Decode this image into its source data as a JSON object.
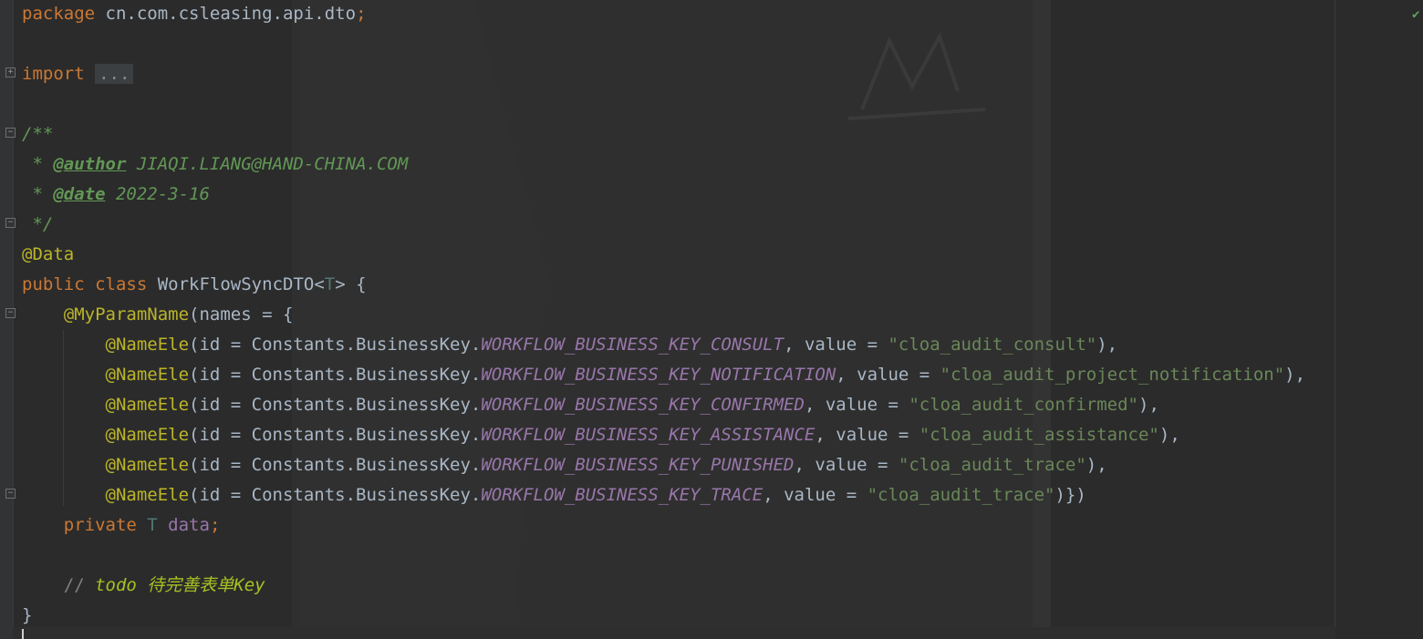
{
  "code": {
    "package_kw": "package",
    "package_name": " cn.com.csleasing.api.dto",
    "semi": ";",
    "import_kw": "import",
    "import_fold": "...",
    "doc_open": "/**",
    "doc_star": " * ",
    "author_tag": "@author",
    "author_value": " JIAQI.LIANG@HAND-CHINA.COM",
    "date_tag": "@date",
    "date_value": " 2022-3-16",
    "doc_close": " */",
    "data_ann": "@Data",
    "public_kw": "public",
    "class_kw": "class",
    "class_name": " WorkFlowSyncDTO<",
    "type_param": "T",
    "class_tail": "> {",
    "myparam_ann": "@MyParamName",
    "myparam_open": "(names = {",
    "name_ele_rows": [
      {
        "ann": "@NameEle",
        "pre": "(id = Constants.BusinessKey.",
        "key": "WORKFLOW_BUSINESS_KEY_CONSULT",
        "mid": ", value = ",
        "val": "\"cloa_audit_consult\"",
        "end": "),"
      },
      {
        "ann": "@NameEle",
        "pre": "(id = Constants.BusinessKey.",
        "key": "WORKFLOW_BUSINESS_KEY_NOTIFICATION",
        "mid": ", value = ",
        "val": "\"cloa_audit_project_notification\"",
        "end": "),"
      },
      {
        "ann": "@NameEle",
        "pre": "(id = Constants.BusinessKey.",
        "key": "WORKFLOW_BUSINESS_KEY_CONFIRMED",
        "mid": ", value = ",
        "val": "\"cloa_audit_confirmed\"",
        "end": "),"
      },
      {
        "ann": "@NameEle",
        "pre": "(id = Constants.BusinessKey.",
        "key": "WORKFLOW_BUSINESS_KEY_ASSISTANCE",
        "mid": ", value = ",
        "val": "\"cloa_audit_assistance\"",
        "end": "),"
      },
      {
        "ann": "@NameEle",
        "pre": "(id = Constants.BusinessKey.",
        "key": "WORKFLOW_BUSINESS_KEY_PUNISHED",
        "mid": ", value = ",
        "val": "\"cloa_audit_trace\"",
        "end": "),"
      },
      {
        "ann": "@NameEle",
        "pre": "(id = Constants.BusinessKey.",
        "key": "WORKFLOW_BUSINESS_KEY_TRACE",
        "mid": ", value = ",
        "val": "\"cloa_audit_trace\"",
        "end": ")})"
      }
    ],
    "private_kw": "private",
    "field_type": " T",
    "field_name": " data",
    "comment_slashes": "// ",
    "todo_text": "todo 待完善表单Key",
    "close_brace": "}"
  },
  "status": {
    "check_icon": "check-icon"
  },
  "colors": {
    "background": "#2b2b2b",
    "keyword": "#cc7832",
    "annotation": "#bbb529",
    "string": "#6a8759",
    "constant": "#9876aa",
    "javadoc": "#629755",
    "todo": "#a8c023"
  }
}
